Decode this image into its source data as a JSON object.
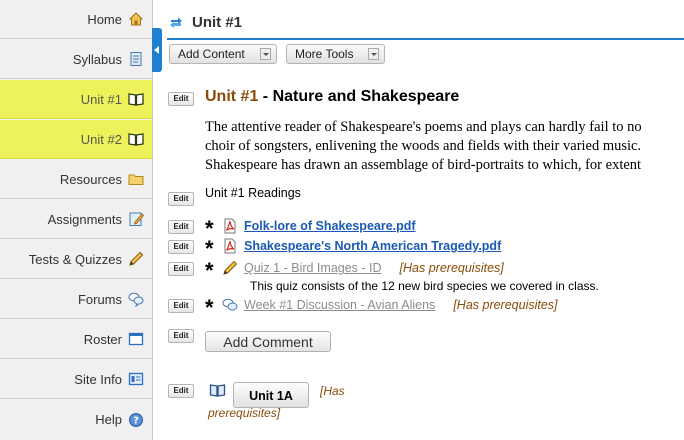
{
  "sidebar": {
    "items": [
      {
        "label": "Home",
        "icon": "home-icon"
      },
      {
        "label": "Syllabus",
        "icon": "syllabus-icon"
      },
      {
        "label": "Unit #1",
        "icon": "book-icon",
        "active": true
      },
      {
        "label": "Unit #2",
        "icon": "book-icon",
        "active": true
      },
      {
        "label": "Resources",
        "icon": "folder-icon"
      },
      {
        "label": "Assignments",
        "icon": "assignment-icon"
      },
      {
        "label": "Tests & Quizzes",
        "icon": "pencil-icon"
      },
      {
        "label": "Forums",
        "icon": "chat-bubbles-icon"
      },
      {
        "label": "Roster",
        "icon": "roster-icon"
      },
      {
        "label": "Site Info",
        "icon": "site-info-icon"
      },
      {
        "label": "Help",
        "icon": "help-icon"
      }
    ]
  },
  "header": {
    "title": "Unit #1"
  },
  "toolbar": {
    "add_content": "Add Content",
    "more_tools": "More Tools"
  },
  "edit_label": "Edit",
  "unit": {
    "number": "Unit #1",
    "separator": " - ",
    "name": "Nature and Shakespeare",
    "description_lines": [
      "The attentive reader of Shakespeare's poems and plays can hardly fail to no",
      "choir of songsters, enlivening the woods and fields with their varied music.",
      "Shakespeare has drawn an assemblage of bird-portraits to which, for extent"
    ]
  },
  "readings_heading": "Unit #1 Readings",
  "items": [
    {
      "star": "*",
      "icon": "pdf-icon",
      "title": "Folk-lore of Shakespeare.pdf",
      "prereq": ""
    },
    {
      "star": "*",
      "icon": "pdf-icon",
      "title": "Shakespeare's North American Tragedy.pdf",
      "prereq": ""
    },
    {
      "star": "*",
      "icon": "pencil-icon",
      "title": "Quiz 1 - Bird Images - ID",
      "prereq": "[Has prerequisites]"
    },
    {
      "star": "*",
      "icon": "chat-bubbles-icon",
      "title": "Week #1 Discussion - Avian Aliens",
      "prereq": "[Has prerequisites]"
    }
  ],
  "quiz_description": "This quiz consists of the 12 new bird species we covered in class.",
  "add_comment": "Add Comment",
  "subpage": {
    "label": "Unit 1A",
    "prereq_line1": "[Has",
    "prereq_line2": "prerequisites]"
  },
  "colors": {
    "active_nav": "#eef25a",
    "accent": "#1e7fcf",
    "prereq": "#8a4b08",
    "link": "#1a5ab4"
  }
}
